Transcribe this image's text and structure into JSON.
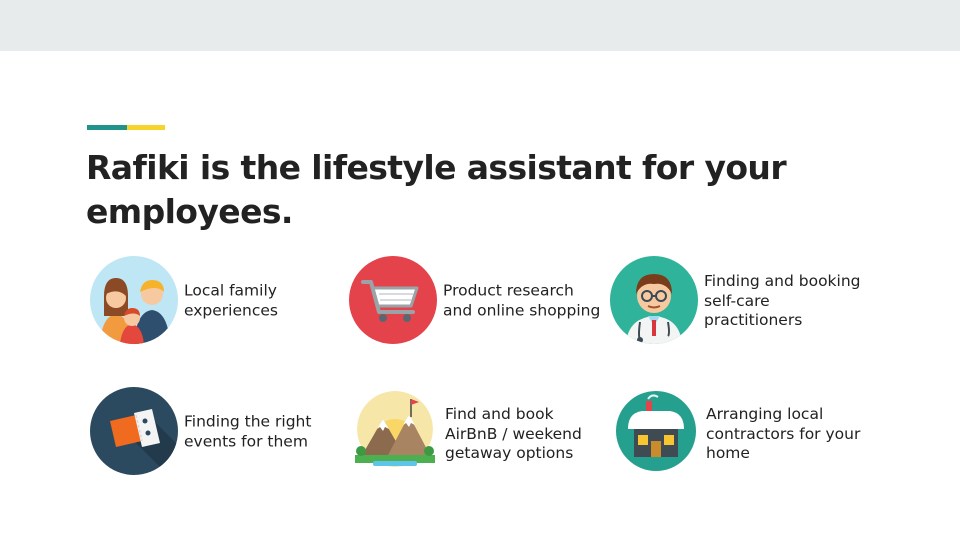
{
  "slide": {
    "title": "Rafiki is the lifestyle assistant for your employees.",
    "colors": {
      "accent_teal": "#22938a",
      "accent_yellow": "#f7d42c",
      "header_bar": "#e8ebec"
    }
  },
  "features": [
    {
      "icon": "family-icon",
      "label": "Local family\nexperiences"
    },
    {
      "icon": "shopping-cart-icon",
      "label": "Product research\nand online shopping"
    },
    {
      "icon": "doctor-icon",
      "label": "Finding and booking\nself-care\npractitioners"
    },
    {
      "icon": "ticket-icon",
      "label": "Finding the right\nevents for them"
    },
    {
      "icon": "mountain-getaway-icon",
      "label": "Find and book\nAirBnB / weekend\ngetaway options"
    },
    {
      "icon": "house-icon",
      "label": "Arranging local\ncontractors for your\nhome"
    }
  ]
}
